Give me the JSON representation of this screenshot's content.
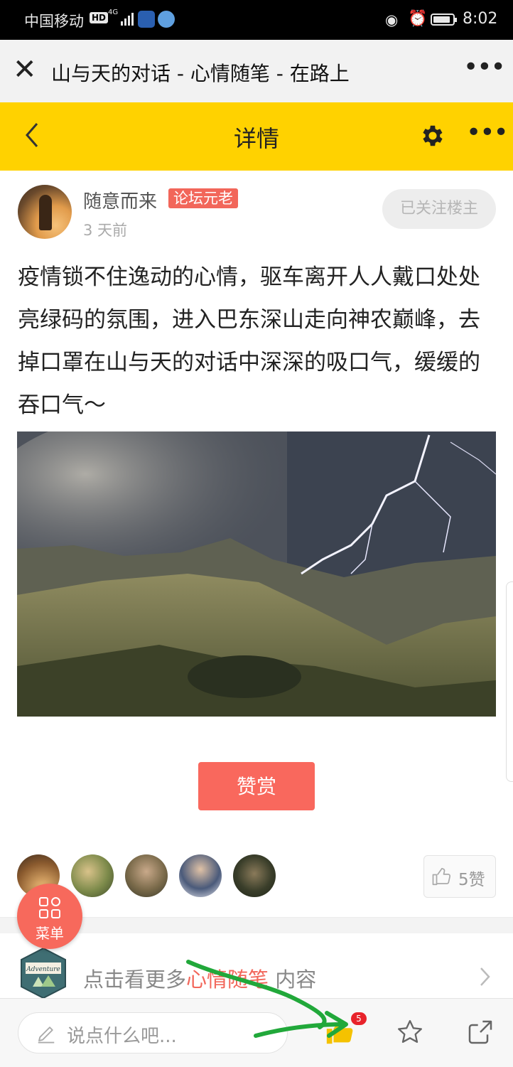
{
  "status_bar": {
    "carrier": "中国移动",
    "hd": "HD",
    "network": "4G",
    "time": "8:02"
  },
  "webview": {
    "title": "山与天的对话 - 心情随笔 - 在路上",
    "close_icon": "close-icon",
    "more_icon": "more-dots-icon"
  },
  "app_header": {
    "title": "详情",
    "back_icon": "chevron-left-icon",
    "settings_icon": "gear-icon",
    "more_icon": "more-dots-icon",
    "background": "#ffd200"
  },
  "author": {
    "name": "随意而来",
    "badge": "论坛元老",
    "time": "3 天前",
    "follow_label": "已关注楼主"
  },
  "post": {
    "text": "疫情锁不住逸动的心情，驱车离开人人戴口处处亮绿码的氛围，进入巴东深山走向神农巅峰，去掉口罩在山与天的对话中深深的吸口气，缓缓的吞口气～",
    "image_desc_icon": "mountain-lightning-photo"
  },
  "reward": {
    "label": "赞赏",
    "color": "#f9685d"
  },
  "likes": {
    "count_label": "5赞",
    "avatars": 5
  },
  "menu_fab": {
    "label": "菜单"
  },
  "category": {
    "prefix": "点击看更多",
    "name": "心情随笔",
    "suffix": " 内容",
    "logo_text": "Adventure"
  },
  "bottom_bar": {
    "comment_placeholder": "说点什么吧...",
    "like_badge": "5",
    "accent": "#f5c200"
  }
}
